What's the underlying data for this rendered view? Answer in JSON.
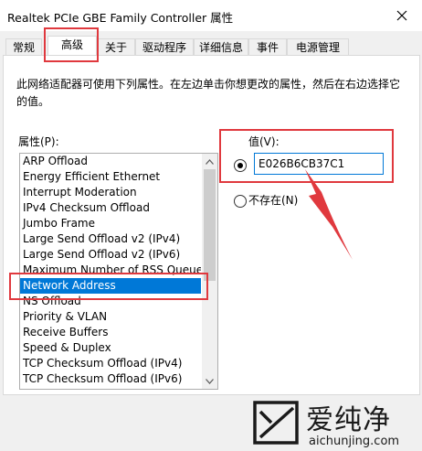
{
  "window": {
    "title": "Realtek PCIe GBE Family Controller 属性"
  },
  "tabs": [
    {
      "label": "常规",
      "active": false
    },
    {
      "label": "高级",
      "active": true
    },
    {
      "label": "关于",
      "active": false
    },
    {
      "label": "驱动程序",
      "active": false
    },
    {
      "label": "详细信息",
      "active": false
    },
    {
      "label": "事件",
      "active": false
    },
    {
      "label": "电源管理",
      "active": false
    }
  ],
  "advanced": {
    "description": "此网络适配器可使用下列属性。在左边单击你想更改的属性，然后在右边选择它的值。",
    "property_label": "属性(P):",
    "properties": [
      "ARP Offload",
      "Energy Efficient Ethernet",
      "Interrupt Moderation",
      "IPv4 Checksum Offload",
      "Jumbo Frame",
      "Large Send Offload v2 (IPv4)",
      "Large Send Offload v2 (IPv6)",
      "Maximum Number of RSS Queue",
      "Network Address",
      "NS Offload",
      "Priority & VLAN",
      "Receive Buffers",
      "Speed & Duplex",
      "TCP Checksum Offload (IPv4)",
      "TCP Checksum Offload (IPv6)"
    ],
    "selected_property": "Network Address",
    "value_label": "值(V):",
    "value": "E026B6CB37C1",
    "not_present_label": "不存在(N)",
    "value_radio_selected": true
  },
  "watermark": {
    "brand": "爱纯净",
    "url": "aichunjing.com"
  },
  "colors": {
    "annotation": "#e0393e",
    "selection": "#0078d7"
  }
}
